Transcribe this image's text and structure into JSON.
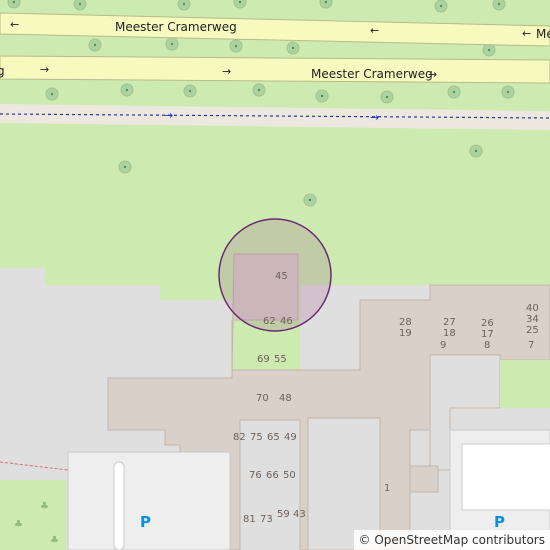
{
  "map": {
    "colors": {
      "grass": "#cdebb0",
      "residential": "#e0dfdf",
      "building": "#d9d0c9",
      "road": "#f7fabf",
      "path": "#f2efe9",
      "selection_fill": "#9b5b8f",
      "selection_stroke": "#6a2c70",
      "house_number": "#6e6259",
      "parking": "#0a90d9"
    },
    "roads": [
      {
        "name": "Meester Cramerweg",
        "direction_arrows": [
          "←",
          "←",
          "←"
        ],
        "partial_label": "Me"
      },
      {
        "name": "Meester Cramerweg",
        "direction_arrows": [
          "→",
          "→",
          "→"
        ],
        "partial_label": "g"
      }
    ],
    "house_numbers": [
      "45",
      "62",
      "46",
      "69",
      "55",
      "70",
      "48",
      "82",
      "75",
      "65",
      "49",
      "76",
      "66",
      "50",
      "81",
      "73",
      "59",
      "43",
      "1",
      "28",
      "19",
      "27",
      "18",
      "9",
      "26",
      "17",
      "8",
      "40",
      "34",
      "25",
      "7"
    ],
    "parking_labels": [
      "P",
      "P"
    ],
    "icons": [
      "tree-icon",
      "parking-icon",
      "one-way-arrow-icon"
    ],
    "attribution": "© OpenStreetMap contributors"
  }
}
